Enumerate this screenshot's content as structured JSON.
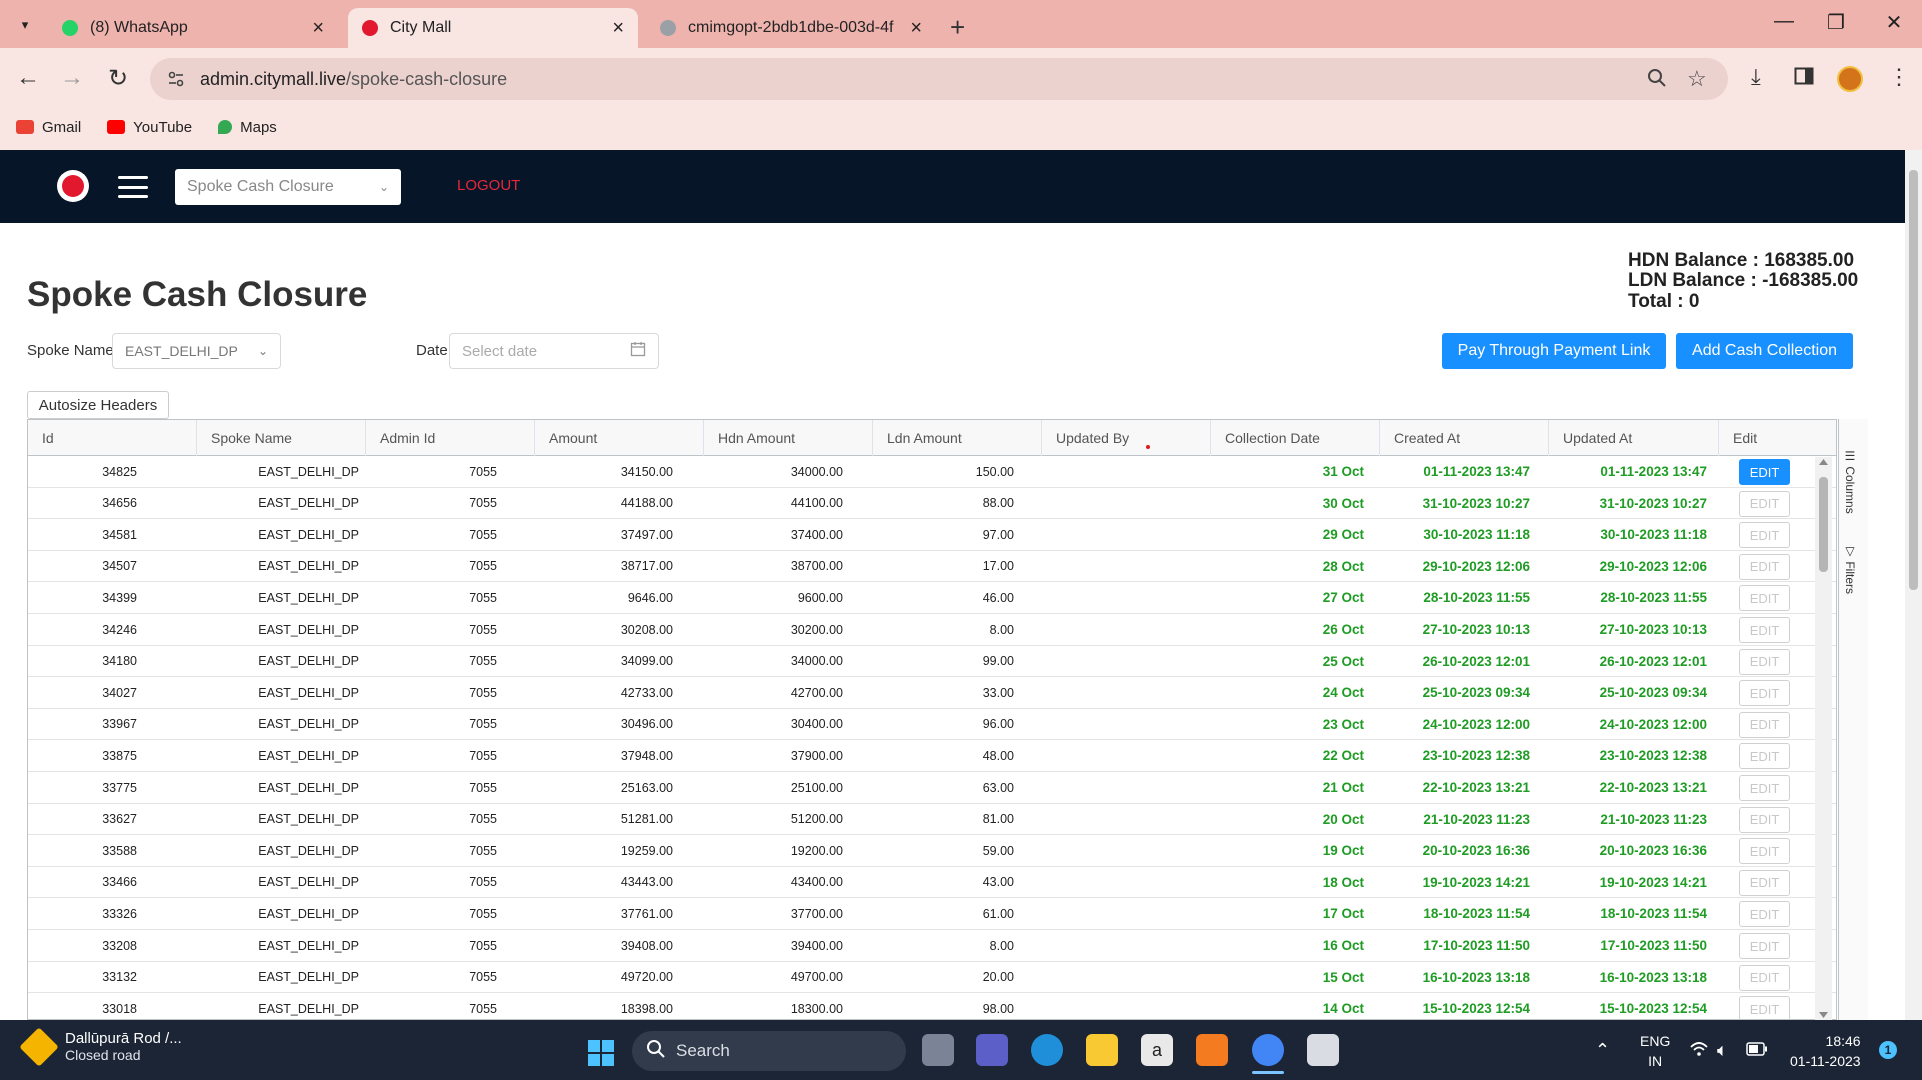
{
  "browser": {
    "tabs": [
      {
        "title": "(8) WhatsApp",
        "active": false,
        "color": "#25d366"
      },
      {
        "title": "City Mall",
        "active": true,
        "color": "#e2182e"
      },
      {
        "title": "cmimgopt-2bdb1dbe-003d-4f",
        "active": false,
        "color": "#9aa0a6"
      }
    ],
    "new_tab": "+",
    "url_domain": "admin.citymall.live",
    "url_path": "/spoke-cash-closure",
    "bookmarks": [
      {
        "label": "Gmail",
        "color": "#ea4335"
      },
      {
        "label": "YouTube",
        "color": "#ff0000"
      },
      {
        "label": "Maps",
        "color": "#34a853"
      }
    ]
  },
  "app": {
    "page_select": "Spoke Cash Closure",
    "logout": "LOGOUT",
    "title": "Spoke Cash Closure",
    "hdn_balance": "HDN Balance : 168385.00",
    "ldn_balance": "LDN Balance : -168385.00",
    "total": "Total : 0",
    "filters": {
      "spoke_label": "Spoke Name",
      "spoke_value": "EAST_DELHI_DP",
      "date_label": "Date",
      "date_placeholder": "Select date"
    },
    "buttons": {
      "pay_link": "Pay Through Payment Link",
      "add_cash": "Add Cash Collection",
      "autosize": "Autosize Headers"
    },
    "side_tabs": [
      "Columns",
      "Filters"
    ],
    "columns": [
      "Id",
      "Spoke Name",
      "Admin Id",
      "Amount",
      "Hdn Amount",
      "Ldn Amount",
      "Updated By",
      "Collection Date",
      "Created At",
      "Updated At",
      "Edit"
    ],
    "edit_label": "EDIT",
    "rows": [
      [
        "34825",
        "EAST_DELHI_DP",
        "7055",
        "34150.00",
        "34000.00",
        "150.00",
        "",
        "31 Oct",
        "01-11-2023 13:47",
        "01-11-2023 13:47"
      ],
      [
        "34656",
        "EAST_DELHI_DP",
        "7055",
        "44188.00",
        "44100.00",
        "88.00",
        "",
        "30 Oct",
        "31-10-2023 10:27",
        "31-10-2023 10:27"
      ],
      [
        "34581",
        "EAST_DELHI_DP",
        "7055",
        "37497.00",
        "37400.00",
        "97.00",
        "",
        "29 Oct",
        "30-10-2023 11:18",
        "30-10-2023 11:18"
      ],
      [
        "34507",
        "EAST_DELHI_DP",
        "7055",
        "38717.00",
        "38700.00",
        "17.00",
        "",
        "28 Oct",
        "29-10-2023 12:06",
        "29-10-2023 12:06"
      ],
      [
        "34399",
        "EAST_DELHI_DP",
        "7055",
        "9646.00",
        "9600.00",
        "46.00",
        "",
        "27 Oct",
        "28-10-2023 11:55",
        "28-10-2023 11:55"
      ],
      [
        "34246",
        "EAST_DELHI_DP",
        "7055",
        "30208.00",
        "30200.00",
        "8.00",
        "",
        "26 Oct",
        "27-10-2023 10:13",
        "27-10-2023 10:13"
      ],
      [
        "34180",
        "EAST_DELHI_DP",
        "7055",
        "34099.00",
        "34000.00",
        "99.00",
        "",
        "25 Oct",
        "26-10-2023 12:01",
        "26-10-2023 12:01"
      ],
      [
        "34027",
        "EAST_DELHI_DP",
        "7055",
        "42733.00",
        "42700.00",
        "33.00",
        "",
        "24 Oct",
        "25-10-2023 09:34",
        "25-10-2023 09:34"
      ],
      [
        "33967",
        "EAST_DELHI_DP",
        "7055",
        "30496.00",
        "30400.00",
        "96.00",
        "",
        "23 Oct",
        "24-10-2023 12:00",
        "24-10-2023 12:00"
      ],
      [
        "33875",
        "EAST_DELHI_DP",
        "7055",
        "37948.00",
        "37900.00",
        "48.00",
        "",
        "22 Oct",
        "23-10-2023 12:38",
        "23-10-2023 12:38"
      ],
      [
        "33775",
        "EAST_DELHI_DP",
        "7055",
        "25163.00",
        "25100.00",
        "63.00",
        "",
        "21 Oct",
        "22-10-2023 13:21",
        "22-10-2023 13:21"
      ],
      [
        "33627",
        "EAST_DELHI_DP",
        "7055",
        "51281.00",
        "51200.00",
        "81.00",
        "",
        "20 Oct",
        "21-10-2023 11:23",
        "21-10-2023 11:23"
      ],
      [
        "33588",
        "EAST_DELHI_DP",
        "7055",
        "19259.00",
        "19200.00",
        "59.00",
        "",
        "19 Oct",
        "20-10-2023 16:36",
        "20-10-2023 16:36"
      ],
      [
        "33466",
        "EAST_DELHI_DP",
        "7055",
        "43443.00",
        "43400.00",
        "43.00",
        "",
        "18 Oct",
        "19-10-2023 14:21",
        "19-10-2023 14:21"
      ],
      [
        "33326",
        "EAST_DELHI_DP",
        "7055",
        "37761.00",
        "37700.00",
        "61.00",
        "",
        "17 Oct",
        "18-10-2023 11:54",
        "18-10-2023 11:54"
      ],
      [
        "33208",
        "EAST_DELHI_DP",
        "7055",
        "39408.00",
        "39400.00",
        "8.00",
        "",
        "16 Oct",
        "17-10-2023 11:50",
        "17-10-2023 11:50"
      ],
      [
        "33132",
        "EAST_DELHI_DP",
        "7055",
        "49720.00",
        "49700.00",
        "20.00",
        "",
        "15 Oct",
        "16-10-2023 13:18",
        "16-10-2023 13:18"
      ],
      [
        "33018",
        "EAST_DELHI_DP",
        "7055",
        "18398.00",
        "18300.00",
        "98.00",
        "",
        "14 Oct",
        "15-10-2023 12:54",
        "15-10-2023 12:54"
      ]
    ]
  },
  "taskbar": {
    "weather_title": "Dallūpurā Rod /...",
    "weather_sub": "Closed road",
    "search": "Search",
    "lang": "ENG",
    "region": "IN",
    "time": "18:46",
    "date": "01-11-2023",
    "notification_count": "1"
  },
  "colors": {
    "appbar": "#071529",
    "accent": "#1890ff",
    "logout": "#e4283a",
    "date_green": "#1f9c24",
    "chrome": "#efb3ae"
  }
}
